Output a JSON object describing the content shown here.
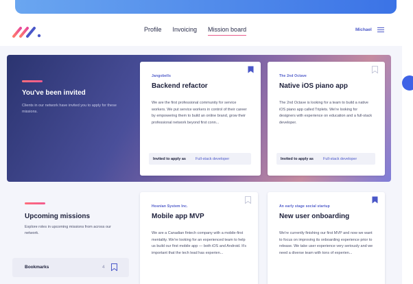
{
  "header": {
    "nav": [
      "Profile",
      "Invoicing",
      "Mission board"
    ],
    "active_index": 2,
    "user_name": "Michael",
    "menu_icon": "hamburger-icon",
    "logo_icon": "brand-logo"
  },
  "hero": {
    "title": "You've been invited",
    "description": "Clients in our network have invited you to apply for these missions."
  },
  "invited_missions": [
    {
      "company": "Jangobells",
      "title": "Backend refactor",
      "description": "We are the first professional community for service workers.  We put service workers in control of their career by empowering them to build an online brand, grow their professional network beyond first conn...",
      "status": "Invited to apply as",
      "role": "Full-stack developer",
      "bookmarked": true
    },
    {
      "company": "The 2nd Octave",
      "title": "Native iOS piano app",
      "description": "The 2nd Octave is looking for a team to build a native iOS piano app called Triplets. We're looking for designers with experience on education and a full-stack developer.",
      "status": "Invited to apply as",
      "role": "Full-stack developer",
      "bookmarked": false
    }
  ],
  "upcoming": {
    "title": "Upcoming missions",
    "description": "Explore roles in upcoming missions from across our network.",
    "bookmarks_label": "Bookmarks",
    "bookmarks_count": "4"
  },
  "upcoming_missions": [
    {
      "company": "Hosnian System Inc.",
      "title": "Mobile app MVP",
      "description": "We are a Canadian fintech company with a mobile-first mentality. We're looking for an experienced team to help us build our first mobile app — both iOS and Android. It's important that the tech lead has experien...",
      "bookmarked": false
    },
    {
      "company": "An early stage social startup",
      "title": "New user onboarding",
      "description": "We're currently finishing our first MVP and now we want to focus on improving its onboarding experience prior to release. We take user experience very seriously and we need a diverse team with tons of experien...",
      "bookmarked": true
    }
  ],
  "colors": {
    "accent": "#4a57c8",
    "pink": "#f25b8f",
    "hero_dark": "#2b3470"
  }
}
